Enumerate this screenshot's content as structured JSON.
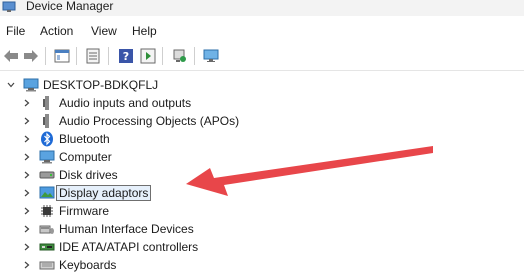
{
  "window": {
    "title": "Device Manager"
  },
  "menu": {
    "items": [
      "File",
      "Action",
      "View",
      "Help"
    ]
  },
  "toolbar": {
    "buttons": [
      "back-arrow-icon",
      "forward-arrow-icon",
      "show-hide-console-tree-icon",
      "properties-icon",
      "help-icon",
      "run-icon",
      "scan-hardware-icon",
      "display-icon"
    ]
  },
  "tree": {
    "root": "DESKTOP-BDKQFLJ",
    "items": [
      {
        "label": "Audio inputs and outputs",
        "icon": "speaker-icon"
      },
      {
        "label": "Audio Processing Objects (APOs)",
        "icon": "speaker-icon"
      },
      {
        "label": "Bluetooth",
        "icon": "bluetooth-icon"
      },
      {
        "label": "Computer",
        "icon": "monitor-icon"
      },
      {
        "label": "Disk drives",
        "icon": "disk-drive-icon"
      },
      {
        "label": "Display adaptors",
        "icon": "display-adapter-icon",
        "selected": true
      },
      {
        "label": "Firmware",
        "icon": "chip-icon"
      },
      {
        "label": "Human Interface Devices",
        "icon": "hid-icon"
      },
      {
        "label": "IDE ATA/ATAPI controllers",
        "icon": "controller-icon"
      },
      {
        "label": "Keyboards",
        "icon": "keyboard-icon"
      }
    ]
  },
  "annotation": {
    "arrow_color": "#e8464a"
  }
}
